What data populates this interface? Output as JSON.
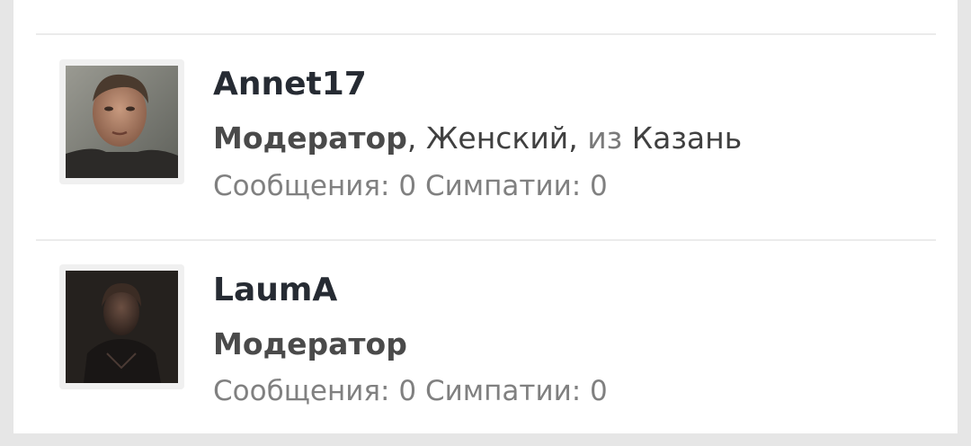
{
  "members": [
    {
      "username": "Annet17",
      "role": "Модератор",
      "sep1": ", ",
      "gender": "Женский",
      "sep2": ", ",
      "from_label": "из ",
      "location": "Казань",
      "messages_label": "Сообщения:",
      "messages_value": "0",
      "likes_label": "Симпатии:",
      "likes_value": "0",
      "avatar_icon": "user-photo-avatar"
    },
    {
      "username": "LaumA",
      "role": "Модератор",
      "messages_label": "Сообщения:",
      "messages_value": "0",
      "likes_label": "Симпатии:",
      "likes_value": "0",
      "avatar_icon": "user-photo-avatar"
    }
  ],
  "colors": {
    "username": "#262b33",
    "role": "#4a4a4a",
    "muted_text": "#7a7a7a",
    "divider": "#ebebeb",
    "background": "#ffffff"
  }
}
